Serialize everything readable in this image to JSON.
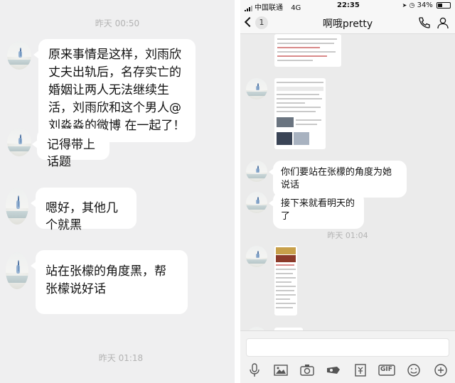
{
  "left_chat": {
    "timestamp_top": "昨天 00:50",
    "messages": [
      "原来事情是这样，刘雨欣丈夫出轨后，名存实亡的婚姻让两人无法继续生活，刘雨欣和这个男人@刘淼淼的微博 在一起了！",
      "记得带上话题",
      "嗯好，其他几个就黑",
      "站在张檬的角度黑，帮张檬说好话"
    ],
    "timestamp_bottom": "昨天 01:18"
  },
  "status_bar": {
    "carrier": "中国联通",
    "network": "4G",
    "time": "22:35",
    "battery": "34%"
  },
  "nav": {
    "back_badge": "1",
    "title": "啊哦pretty"
  },
  "right_chat": {
    "messages": [
      "你们要站在张檬的角度为她说话",
      "接下来就看明天的了"
    ],
    "timestamp": "昨天 01:04"
  },
  "input": {
    "toolbar_icons": [
      "voice-icon",
      "image-icon",
      "camera-icon",
      "red-packet-icon",
      "transfer-icon",
      "gif-icon",
      "emoji-icon",
      "plus-icon"
    ],
    "gif_label": "GIF"
  },
  "colors": {
    "chat_background": "#efeff0",
    "bubble": "#ffffff",
    "timestamp": "#b3b3b3"
  }
}
